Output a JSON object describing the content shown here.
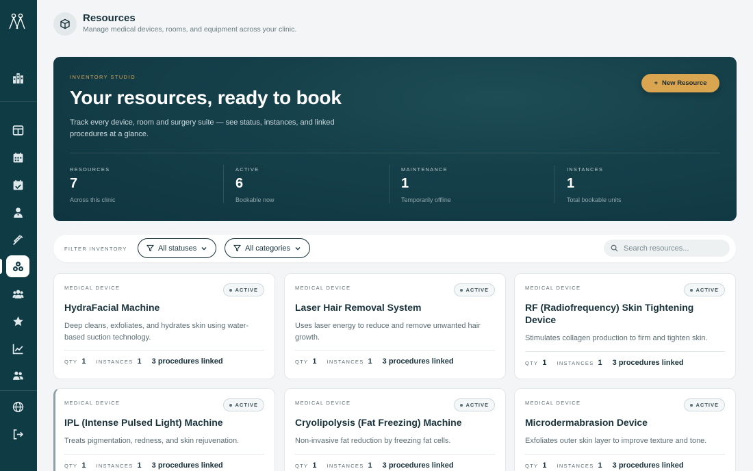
{
  "header": {
    "title": "Resources",
    "subtitle": "Manage medical devices, rooms, and equipment across your clinic."
  },
  "sidebar": {
    "items": [
      {
        "icon": "building-icon"
      },
      {
        "icon": "layout-icon"
      },
      {
        "icon": "calendar-icon"
      },
      {
        "icon": "calendar-check-icon"
      },
      {
        "icon": "user-doctor-icon"
      },
      {
        "icon": "syringe-icon"
      },
      {
        "icon": "resources-icon",
        "active": true
      },
      {
        "icon": "users-icon"
      },
      {
        "icon": "star-icon"
      },
      {
        "icon": "chart-line-icon"
      },
      {
        "icon": "team-icon"
      },
      {
        "icon": "globe-icon"
      },
      {
        "icon": "logout-icon"
      }
    ]
  },
  "hero": {
    "eyebrow": "INVENTORY STUDIO",
    "title": "Your resources, ready to book",
    "description": "Track every device, room and surgery suite — see status, instances, and linked procedures at a glance.",
    "button_label": "New Resource",
    "button_color": "#d9a550",
    "stats": [
      {
        "label": "RESOURCES",
        "value": "7",
        "note": "Across this clinic"
      },
      {
        "label": "ACTIVE",
        "value": "6",
        "note": "Bookable now"
      },
      {
        "label": "MAINTENANCE",
        "value": "1",
        "note": "Temporarily offline"
      },
      {
        "label": "INSTANCES",
        "value": "1",
        "note": "Total bookable units"
      }
    ]
  },
  "filters": {
    "label": "FILTER INVENTORY",
    "status_label": "All statuses",
    "category_label": "All categories",
    "search_placeholder": "Search resources..."
  },
  "cards": [
    {
      "category": "MEDICAL DEVICE",
      "status": "ACTIVE",
      "title": "HydraFacial Machine",
      "description": "Deep cleans, exfoliates, and hydrates skin using water-based suction technology.",
      "qty_label": "QTY",
      "qty": "1",
      "instances_label": "INSTANCES",
      "instances": "1",
      "procedures": "3 procedures linked"
    },
    {
      "category": "MEDICAL DEVICE",
      "status": "ACTIVE",
      "title": "Laser Hair Removal System",
      "description": "Uses laser energy to reduce and remove unwanted hair growth.",
      "qty_label": "QTY",
      "qty": "1",
      "instances_label": "INSTANCES",
      "instances": "1",
      "procedures": "3 procedures linked"
    },
    {
      "category": "MEDICAL DEVICE",
      "status": "ACTIVE",
      "title": "RF (Radiofrequency) Skin Tightening Device",
      "description": "Stimulates collagen production to firm and tighten skin.",
      "qty_label": "QTY",
      "qty": "1",
      "instances_label": "INSTANCES",
      "instances": "1",
      "procedures": "3 procedures linked"
    },
    {
      "category": "MEDICAL DEVICE",
      "status": "ACTIVE",
      "title": "IPL (Intense Pulsed Light) Machine",
      "description": "Treats pigmentation, redness, and skin rejuvenation.",
      "qty_label": "QTY",
      "qty": "1",
      "instances_label": "INSTANCES",
      "instances": "1",
      "procedures": "3 procedures linked"
    },
    {
      "category": "MEDICAL DEVICE",
      "status": "ACTIVE",
      "title": "Cryolipolysis (Fat Freezing) Machine",
      "description": "Non-invasive fat reduction by freezing fat cells.",
      "qty_label": "QTY",
      "qty": "1",
      "instances_label": "INSTANCES",
      "instances": "1",
      "procedures": "3 procedures linked"
    },
    {
      "category": "MEDICAL DEVICE",
      "status": "ACTIVE",
      "title": "Microdermabrasion Device",
      "description": "Exfoliates outer skin layer to improve texture and tone.",
      "qty_label": "QTY",
      "qty": "1",
      "instances_label": "INSTANCES",
      "instances": "1",
      "procedures": "3 procedures linked"
    }
  ]
}
